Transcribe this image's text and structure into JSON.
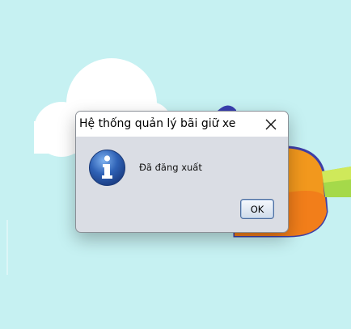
{
  "dialog": {
    "title": "Hệ thống quản lý bãi giữ xe",
    "message": "Đã đăng xuất",
    "ok_label": "OK"
  },
  "icons": {
    "close": "close-icon",
    "info": "info-icon"
  },
  "colors": {
    "background": "#c6f1f2",
    "dialog_body": "#dadde4",
    "info_icon": "#2f62b6",
    "ok_border": "#4f6fa0"
  }
}
